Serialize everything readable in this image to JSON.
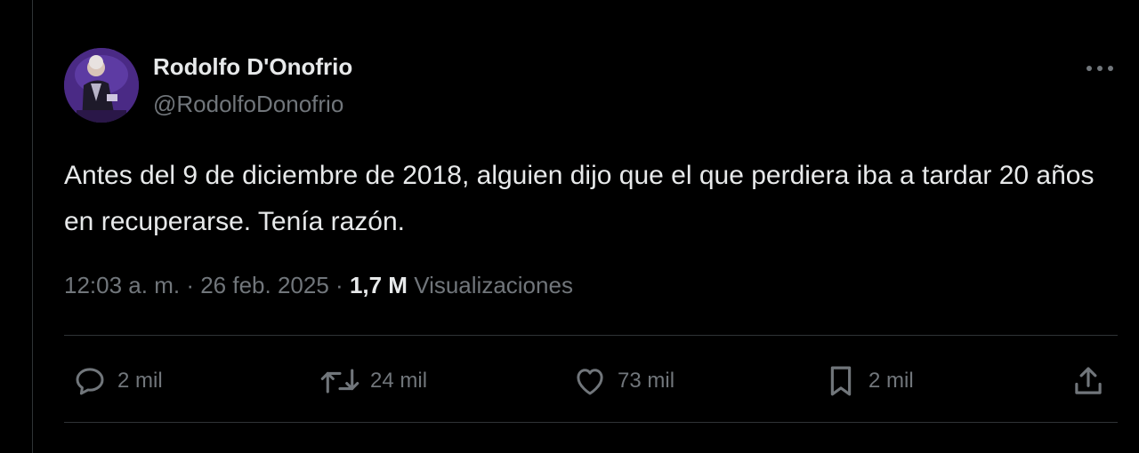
{
  "author": {
    "name": "Rodolfo D'Onofrio",
    "handle": "@RodolfoDonofrio"
  },
  "tweet": {
    "text": "Antes del 9 de diciembre de 2018, alguien dijo que el que perdiera iba a tardar 20 años en recuperarse. Tenía razón.",
    "time": "12:03 a. m.",
    "separator": "·",
    "date": "26 feb. 2025",
    "views_count": "1,7 M",
    "views_label": "Visualizaciones"
  },
  "actions": {
    "replies": "2 mil",
    "reposts": "24 mil",
    "likes": "73 mil",
    "bookmarks": "2 mil"
  },
  "icons": {
    "more": "more-horizontal-icon",
    "reply": "reply-icon",
    "repost": "repost-icon",
    "like": "heart-icon",
    "bookmark": "bookmark-icon",
    "share": "share-icon"
  },
  "colors": {
    "background": "#000000",
    "text_primary": "#e7e9ea",
    "text_secondary": "#71767b",
    "divider": "#2f3336"
  }
}
